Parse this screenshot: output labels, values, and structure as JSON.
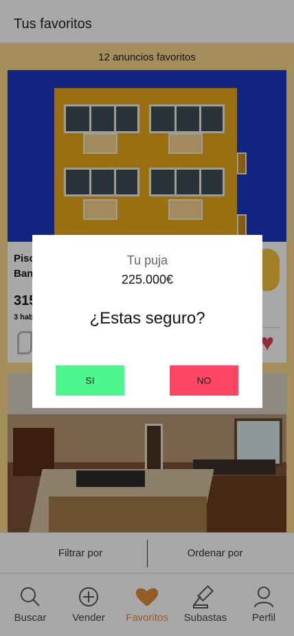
{
  "header": {
    "title": "Tus favoritos"
  },
  "favorites": {
    "count_label": "12 anuncios favoritos"
  },
  "listings": [
    {
      "title_line1": "Pisc",
      "title_line2": "Ban",
      "price": "315",
      "rooms": "3 hab"
    }
  ],
  "filters": {
    "filter_label": "Filtrar por",
    "sort_label": "Ordenar por"
  },
  "tabs": [
    {
      "label": "Buscar",
      "icon": "search-icon"
    },
    {
      "label": "Vender",
      "icon": "plus-circle-icon"
    },
    {
      "label": "Favoritos",
      "icon": "heart-icon",
      "active": true
    },
    {
      "label": "Subastas",
      "icon": "gavel-icon"
    },
    {
      "label": "Perfil",
      "icon": "user-icon"
    }
  ],
  "modal": {
    "title": "Tu puja",
    "amount": "225.000€",
    "question": "¿Estas seguro?",
    "yes_label": "SI",
    "no_label": "NO"
  },
  "colors": {
    "accent": "#e08a3a",
    "favorites_bg": "#f9d88c",
    "yes_button": "#4ff58e",
    "no_button": "#ff4663",
    "heart": "#e63b52"
  }
}
